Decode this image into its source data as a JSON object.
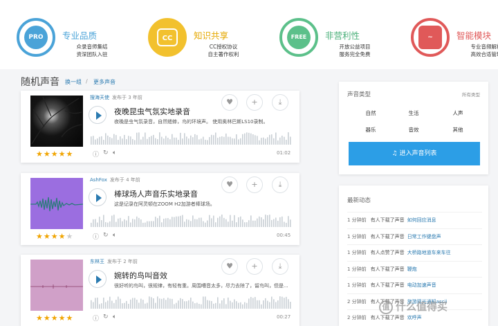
{
  "features": [
    {
      "badge": "PRO",
      "title": "专业品质",
      "sub1": "众录音师集结",
      "sub2": "资深团队入驻",
      "color": "#4aa3d8"
    },
    {
      "badge": "CC",
      "title": "知识共享",
      "sub1": "CC授权协议",
      "sub2": "自主著作权利",
      "color": "#f2c12e"
    },
    {
      "badge": "FREE",
      "title": "非营利性",
      "sub1": "开放公益项目",
      "sub2": "服务完全免费",
      "color": "#5cc08a"
    },
    {
      "badge": "~",
      "title": "智能模块",
      "sub1": "专业音频解析",
      "sub2": "高效合适管理",
      "color": "#e05959"
    }
  ],
  "section": {
    "title": "随机声音",
    "link1": "换一组",
    "slash": "/",
    "link2": "更多声音"
  },
  "sounds": [
    {
      "author": "搜海天使",
      "ago": "发布于 3 年前",
      "title": "夜晚昆虫气氛实地录音",
      "desc": "夜晚是虫气氛录音，自然蟋蟀，鸟的环境声。 使用奥林巴斯LS10录制。",
      "duration": "01:02",
      "stars": "★★★★★",
      "stars_off": "",
      "rating": 5
    },
    {
      "author": "AshFox",
      "ago": "发布于 4 年前",
      "title": "棒球场人声音乐实地录音",
      "desc": "这是记录在阿灵顿在ZOOM H2加游者棒球场。",
      "duration": "00:45",
      "stars": "★★★★",
      "stars_off": "★",
      "rating": 4
    },
    {
      "author": "东林王",
      "ago": "发布于 2 年前",
      "title": "婉转的鸟叫音效",
      "desc": "很好听的鸟叫，很规律，有轻有重。周围嘈音太多，尽力去除了，留鸟叫，但是...",
      "duration": "00:27",
      "stars": "★★★★★",
      "stars_off": "",
      "rating": 5
    }
  ],
  "sound_types": {
    "title": "声音类型",
    "more": "所有类型",
    "items": [
      "自然",
      "生活",
      "人声",
      "器乐",
      "音效",
      "其他"
    ],
    "enter_icon": "♫",
    "enter": "进入声音列表"
  },
  "feed": {
    "title": "最新动态",
    "rows": [
      {
        "time": "1 分钟前",
        "action": "有人下载了声音",
        "sound": "如何回应消息"
      },
      {
        "time": "1 分钟前",
        "action": "有人下载了声音",
        "sound": "日常工作键盘声"
      },
      {
        "time": "1 分钟前",
        "action": "有人点赞了声音",
        "sound": "大桥路地道车来车往"
      },
      {
        "time": "1 分钟前",
        "action": "有人下载了声音",
        "sound": "鞭炮"
      },
      {
        "time": "1 分钟前",
        "action": "有人下载了声音",
        "sound": "电动加速声音"
      },
      {
        "time": "2 分钟前",
        "action": "有人下载了声音",
        "sound": "旅游观光通知ascii"
      },
      {
        "time": "2 分钟前",
        "action": "有人下载了声音",
        "sound": "欢呼声"
      }
    ]
  },
  "watermark": {
    "icon": "值",
    "text": "什么值得买"
  },
  "icons": {
    "like": "heart-icon",
    "add": "plus-icon",
    "download": "download-icon"
  },
  "accent": "#2c9ee6"
}
